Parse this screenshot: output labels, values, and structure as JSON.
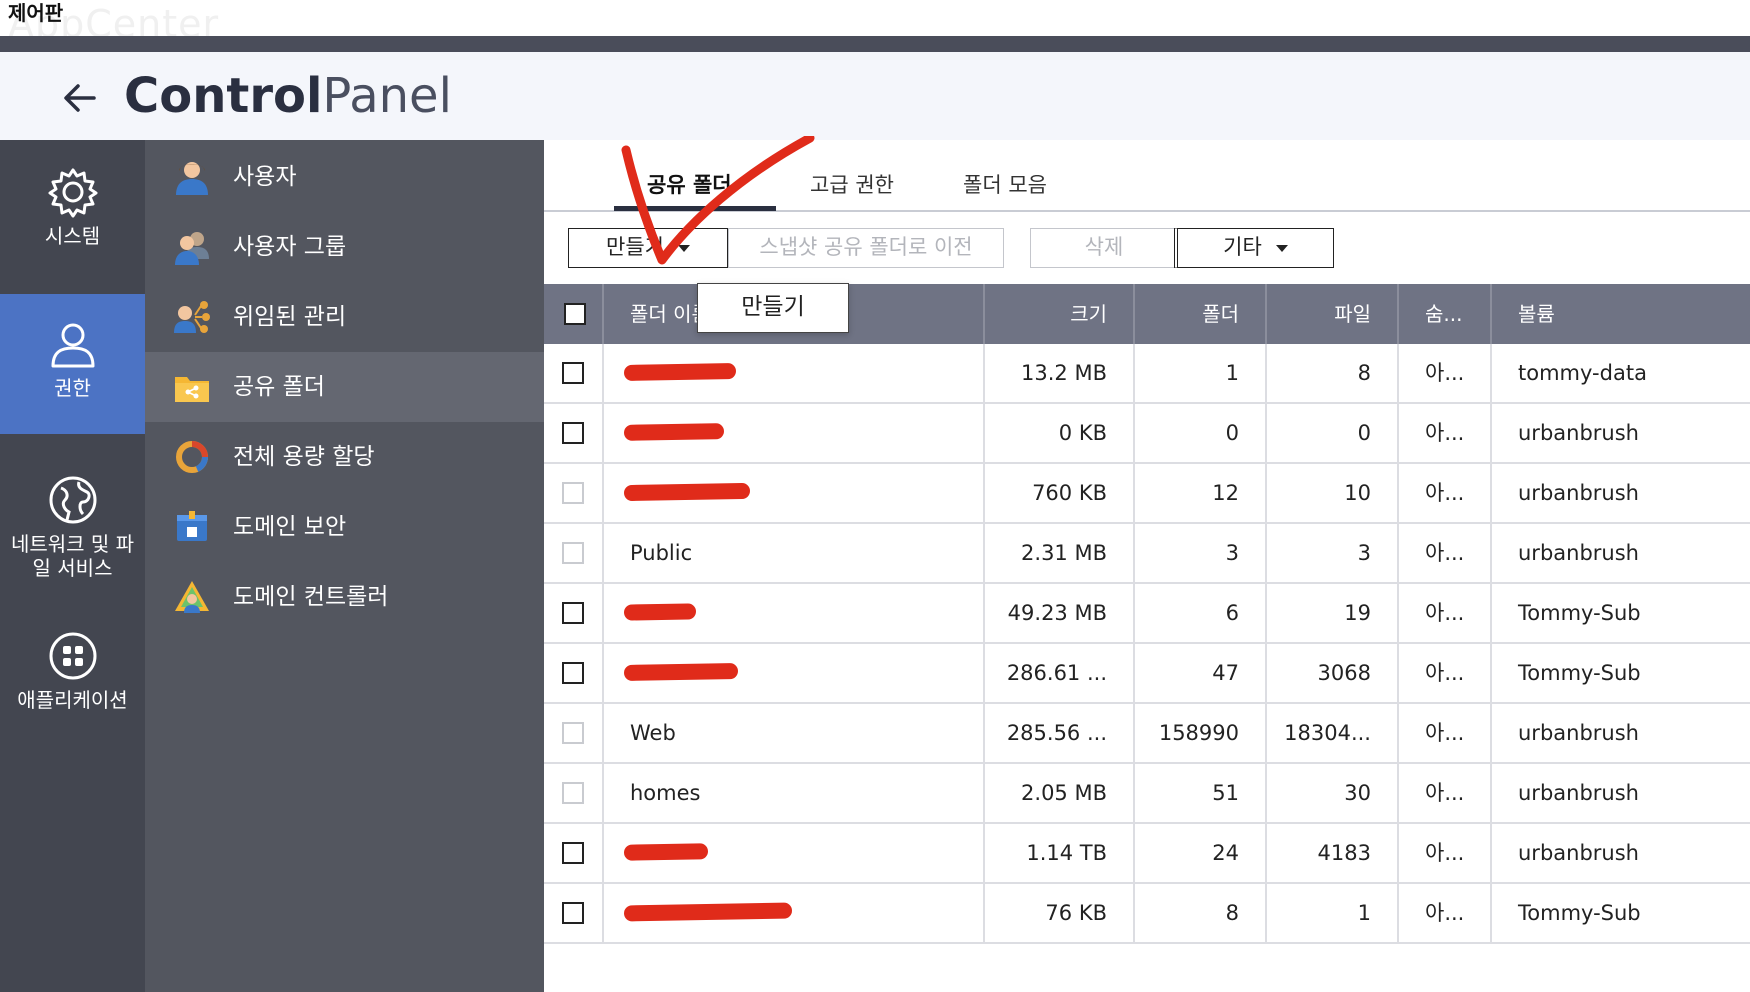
{
  "window": {
    "title": "제어판",
    "ghost_text": "AppCenter"
  },
  "header": {
    "title_bold": "Control",
    "title_light": "Panel"
  },
  "rail": {
    "items": [
      {
        "label": "시스템",
        "icon": "gear-icon"
      },
      {
        "label": "권한",
        "icon": "user-icon",
        "active": true
      },
      {
        "label": "네트워크 및 파일 서비스",
        "icon": "globe-icon"
      },
      {
        "label": "애플리케이션",
        "icon": "grid-icon"
      }
    ]
  },
  "submenu": {
    "items": [
      {
        "label": "사용자",
        "icon": "user-icon"
      },
      {
        "label": "사용자 그룹",
        "icon": "user-group-icon"
      },
      {
        "label": "위임된 관리",
        "icon": "delegated-admin-icon"
      },
      {
        "label": "공유 폴더",
        "icon": "shared-folder-icon",
        "active": true
      },
      {
        "label": "전체 용량 할당",
        "icon": "quota-icon"
      },
      {
        "label": "도메인 보안",
        "icon": "domain-security-icon"
      },
      {
        "label": "도메인 컨트롤러",
        "icon": "domain-controller-icon"
      }
    ]
  },
  "tabs": [
    {
      "label": "공유 폴더",
      "active": true
    },
    {
      "label": "고급 권한"
    },
    {
      "label": "폴더 모음"
    }
  ],
  "toolbar": {
    "create": "만들기",
    "migrate": "스냅샷 공유 폴더로 이전",
    "delete": "삭제",
    "other": "기타"
  },
  "dropdown": {
    "item": "만들기"
  },
  "table": {
    "columns": [
      "폴더 이름",
      "크기",
      "폴더",
      "파일",
      "숨...",
      "볼륨"
    ],
    "rows": [
      {
        "name": "",
        "size": "13.2 MB",
        "folders": "1",
        "files": "8",
        "hidden": "아...",
        "volume": "tommy-data",
        "redacted": true,
        "cb_light": false
      },
      {
        "name": "",
        "size": "0 KB",
        "folders": "0",
        "files": "0",
        "hidden": "아...",
        "volume": "urbanbrush",
        "redacted": true,
        "cb_light": false
      },
      {
        "name": "",
        "size": "760 KB",
        "folders": "12",
        "files": "10",
        "hidden": "아...",
        "volume": "urbanbrush",
        "redacted": true,
        "cb_light": true
      },
      {
        "name": "Public",
        "size": "2.31 MB",
        "folders": "3",
        "files": "3",
        "hidden": "아...",
        "volume": "urbanbrush",
        "redacted": false,
        "cb_light": true
      },
      {
        "name": "",
        "size": "49.23 MB",
        "folders": "6",
        "files": "19",
        "hidden": "아...",
        "volume": "Tommy-Sub",
        "redacted": true,
        "cb_light": false
      },
      {
        "name": "",
        "size": "286.61 ...",
        "folders": "47",
        "files": "3068",
        "hidden": "아...",
        "volume": "Tommy-Sub",
        "redacted": true,
        "cb_light": false
      },
      {
        "name": "Web",
        "size": "285.56 ...",
        "folders": "158990",
        "files": "18304...",
        "hidden": "아...",
        "volume": "urbanbrush",
        "redacted": false,
        "cb_light": true
      },
      {
        "name": "homes",
        "size": "2.05 MB",
        "folders": "51",
        "files": "30",
        "hidden": "아...",
        "volume": "urbanbrush",
        "redacted": false,
        "cb_light": true
      },
      {
        "name": "",
        "size": "1.14 TB",
        "folders": "24",
        "files": "4183",
        "hidden": "아...",
        "volume": "urbanbrush",
        "redacted": true,
        "cb_light": false
      },
      {
        "name": "",
        "size": "76 KB",
        "folders": "8",
        "files": "1",
        "hidden": "아...",
        "volume": "Tommy-Sub",
        "redacted": true,
        "cb_light": false
      }
    ]
  },
  "colors": {
    "accent": "#4c73c4",
    "redaction": "#e02b1a",
    "header_row": "#6f7384"
  }
}
